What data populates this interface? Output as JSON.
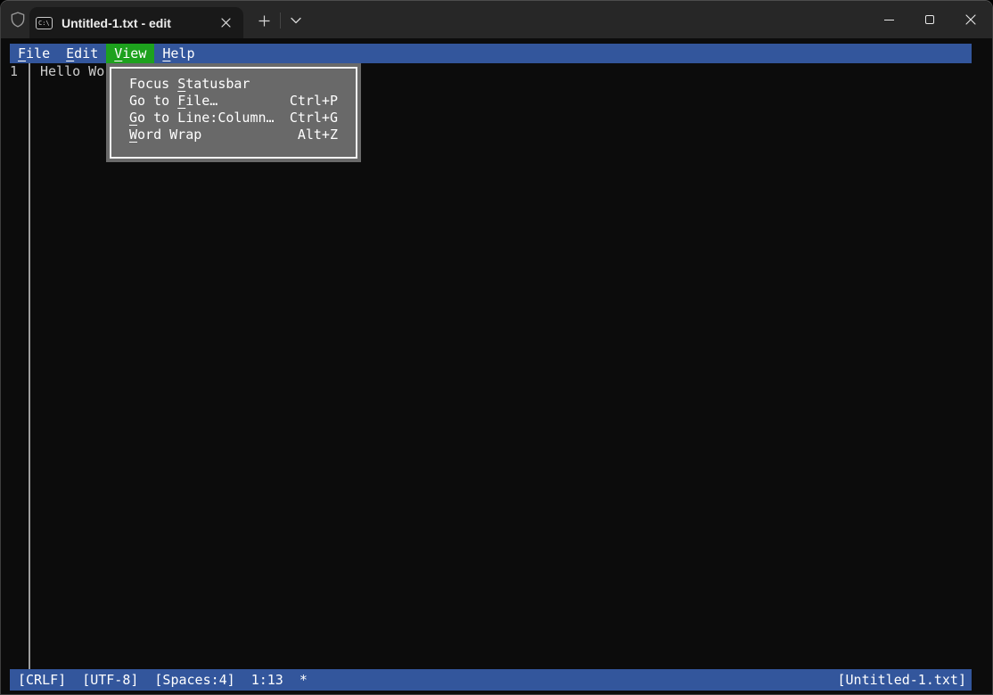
{
  "title_bar": {
    "tab_title": "Untitled-1.txt - edit"
  },
  "icons": {
    "admin_shield": "shield-outline-icon",
    "terminal_badge_text": "C:\\",
    "tab_close": "x-icon",
    "new_tab": "plus-icon",
    "tab_dropdown": "chevron-down-icon",
    "minimize": "horizontal-line-icon",
    "maximize": "square-icon",
    "window_close": "x-icon"
  },
  "menu_bar": {
    "items": [
      {
        "label": "File",
        "underline_index": 0,
        "active": false
      },
      {
        "label": "Edit",
        "underline_index": 0,
        "active": false
      },
      {
        "label": "View",
        "underline_index": 0,
        "active": true
      },
      {
        "label": "Help",
        "underline_index": 0,
        "active": false
      }
    ]
  },
  "view_menu": {
    "items": [
      {
        "label": "Focus Statusbar",
        "underline_index": 6,
        "shortcut": ""
      },
      {
        "label": "Go to File…",
        "underline_index": 6,
        "shortcut": "Ctrl+P"
      },
      {
        "label": "Go to Line:Column…",
        "underline_index": 0,
        "shortcut": "Ctrl+G"
      },
      {
        "label": "Word Wrap",
        "underline_index": 0,
        "shortcut": "Alt+Z"
      }
    ]
  },
  "editor": {
    "line_number": "1",
    "line_text": "Hello Wo"
  },
  "status_bar": {
    "line_ending": "[CRLF]",
    "encoding": "[UTF-8]",
    "indentation": "[Spaces:4]",
    "cursor_position": "1:13",
    "modified_indicator": "*",
    "document_name": "[Untitled-1.txt]"
  },
  "colors": {
    "accent_blue": "#33569C",
    "menu_highlight_green": "#1DA11D",
    "dropdown_gray": "#696969",
    "dropdown_border_white": "#F2F2F2",
    "terminal_background": "#0C0C0C",
    "titlebar_background": "#272727",
    "tab_background": "#191919"
  }
}
